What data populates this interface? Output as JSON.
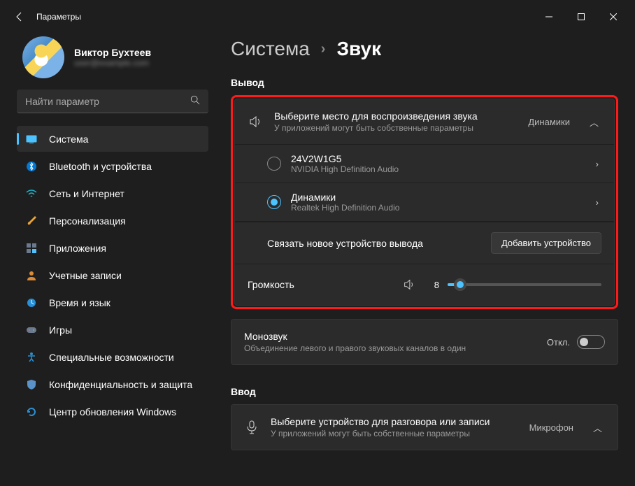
{
  "window": {
    "title": "Параметры"
  },
  "profile": {
    "name": "Виктор Бухтеев",
    "email": "user@example.com"
  },
  "search": {
    "placeholder": "Найти параметр"
  },
  "nav": [
    {
      "label": "Система",
      "active": true
    },
    {
      "label": "Bluetooth и устройства"
    },
    {
      "label": "Сеть и Интернет"
    },
    {
      "label": "Персонализация"
    },
    {
      "label": "Приложения"
    },
    {
      "label": "Учетные записи"
    },
    {
      "label": "Время и язык"
    },
    {
      "label": "Игры"
    },
    {
      "label": "Специальные возможности"
    },
    {
      "label": "Конфиденциальность и защита"
    },
    {
      "label": "Центр обновления Windows"
    }
  ],
  "breadcrumb": {
    "parent": "Система",
    "current": "Звук"
  },
  "output": {
    "section": "Вывод",
    "expander": {
      "title": "Выберите место для воспроизведения звука",
      "sub": "У приложений могут быть собственные параметры",
      "value": "Динамики"
    },
    "devices": [
      {
        "title": "24V2W1G5",
        "sub": "NVIDIA High Definition Audio",
        "selected": false
      },
      {
        "title": "Динамики",
        "sub": "Realtek High Definition Audio",
        "selected": true
      }
    ],
    "pair": {
      "label": "Связать новое устройство вывода",
      "button": "Добавить устройство"
    },
    "volume": {
      "label": "Громкость",
      "value": 8
    }
  },
  "mono": {
    "title": "Монозвук",
    "sub": "Объединение левого и правого звуковых каналов в один",
    "state": "Откл."
  },
  "input": {
    "section": "Ввод",
    "expander": {
      "title": "Выберите устройство для разговора или записи",
      "sub": "У приложений могут быть собственные параметры",
      "value": "Микрофон"
    }
  }
}
